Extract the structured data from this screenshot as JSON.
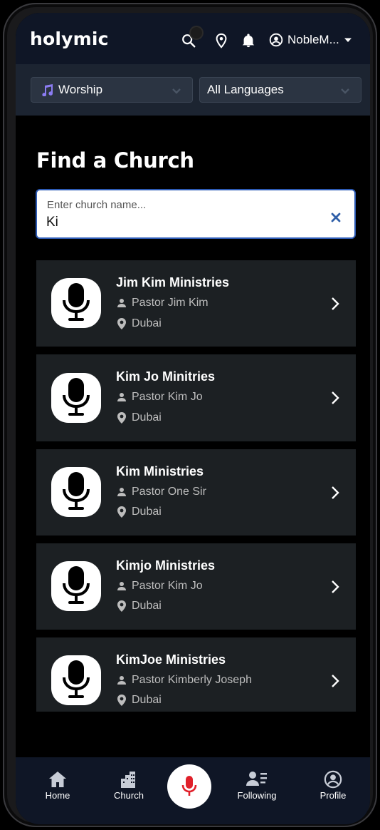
{
  "app": {
    "title": "holymic"
  },
  "header": {
    "user_name": "NobleM...",
    "icons": [
      "search-icon",
      "location-pin-icon",
      "bell-icon",
      "account-circle-icon",
      "caret-down-icon"
    ]
  },
  "filters": {
    "category": {
      "label": "Worship",
      "icon": "music-note-icon"
    },
    "language": {
      "label": "All Languages"
    }
  },
  "page": {
    "title": "Find a Church"
  },
  "search": {
    "label": "Enter church name...",
    "value": "Ki"
  },
  "churches": [
    {
      "name": "Jim Kim Ministries",
      "pastor": "Pastor Jim Kim",
      "location": "Dubai"
    },
    {
      "name": "Kim Jo Minitries",
      "pastor": "Pastor Kim Jo",
      "location": "Dubai"
    },
    {
      "name": "Kim Ministries",
      "pastor": "Pastor One Sir",
      "location": "Dubai"
    },
    {
      "name": "Kimjo Ministries",
      "pastor": "Pastor Kim Jo",
      "location": "Dubai"
    },
    {
      "name": "KimJoe Ministries",
      "pastor": "Pastor Kimberly Joseph",
      "location": "Dubai"
    }
  ],
  "bottom_nav": {
    "items": [
      {
        "label": "Home",
        "icon": "home-icon"
      },
      {
        "label": "Church",
        "icon": "church-building-icon"
      },
      {
        "label": "",
        "icon": "microphone-icon"
      },
      {
        "label": "Following",
        "icon": "following-list-icon"
      },
      {
        "label": "Profile",
        "icon": "profile-circle-icon"
      }
    ]
  },
  "colors": {
    "accent": "#e0202a",
    "topbar": "#0f1626",
    "card": "#1c2023",
    "search_border": "#2d5bb5"
  }
}
